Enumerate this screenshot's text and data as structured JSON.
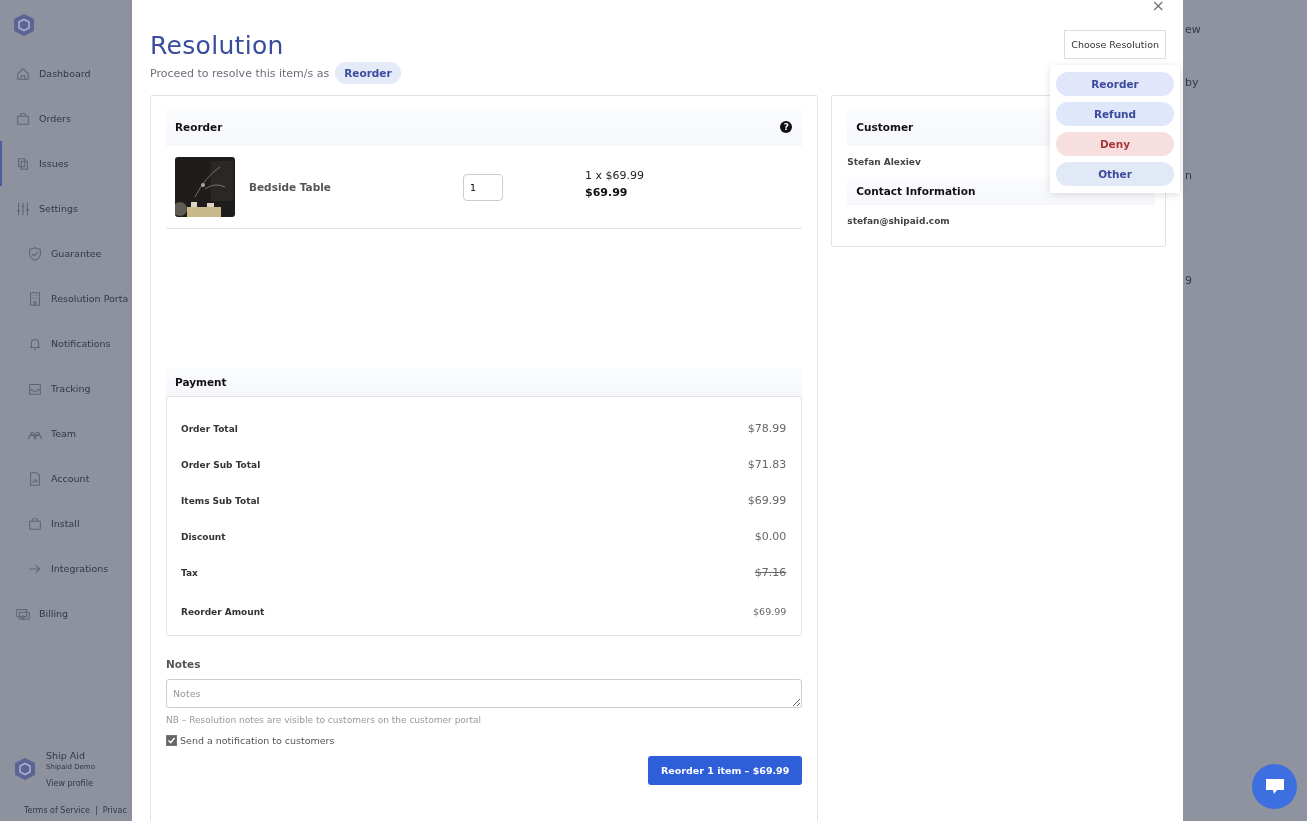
{
  "sidebar": {
    "items": [
      {
        "label": "Dashboard",
        "selected": false
      },
      {
        "label": "Orders",
        "selected": false
      },
      {
        "label": "Issues",
        "selected": true
      },
      {
        "label": "Settings",
        "selected": false,
        "children": [
          {
            "label": "Guarantee",
            "selected": false
          },
          {
            "label": "Resolution Porta",
            "selected": false
          },
          {
            "label": "Notifications",
            "selected": false
          },
          {
            "label": "Tracking",
            "selected": false
          },
          {
            "label": "Team",
            "selected": false
          },
          {
            "label": "Account",
            "selected": false
          },
          {
            "label": "Install",
            "selected": false
          },
          {
            "label": "Integrations",
            "selected": false
          }
        ]
      },
      {
        "label": "Billing",
        "selected": false
      }
    ],
    "profile": {
      "name": "Ship Aid",
      "store": "Shipaid Demo",
      "link": "View profile"
    },
    "footer": {
      "terms": "Terms of Service",
      "separator": "|",
      "privacy": "Privac"
    }
  },
  "background_fragments": [
    "ew",
    "by",
    "n",
    "9"
  ],
  "modal": {
    "close": "×",
    "title": "Resolution",
    "subtitle": "Proceed to resolve this item/s as",
    "badge": "Reorder",
    "choose_button": "Choose Resolution",
    "options": [
      {
        "label": "Reorder",
        "color": "#e2e6fb"
      },
      {
        "label": "Refund",
        "color": "#dfe8fa"
      },
      {
        "label": "Deny",
        "color": "#f8dfdf"
      },
      {
        "label": "Other",
        "color": "#e1e9f7"
      }
    ],
    "reorder": {
      "heading": "Reorder",
      "help": "?",
      "items": [
        {
          "name": "Bedside Table",
          "quantity": "1",
          "unit": "1 x $69.99",
          "total": "$69.99"
        }
      ]
    },
    "payment": {
      "heading": "Payment",
      "rows": [
        {
          "label": "Order Total",
          "value": "$78.99",
          "struck": false
        },
        {
          "label": "Order Sub Total",
          "value": "$71.83",
          "struck": false
        },
        {
          "label": "Items Sub Total",
          "value": "$69.99",
          "struck": false
        },
        {
          "label": "Discount",
          "value": "$0.00",
          "struck": false
        },
        {
          "label": "Tax",
          "value": "$7.16",
          "struck": true
        },
        {
          "label": "Reorder Amount",
          "value": "$69.99",
          "struck": false
        }
      ]
    },
    "notes": {
      "label": "Notes",
      "placeholder": "Notes",
      "hint": "NB – Resolution notes are visible to customers on the customer portal",
      "notify": {
        "label": "Send a notification to customers",
        "checked": true
      }
    },
    "submit": "Reorder 1 item – $69.99",
    "customer": {
      "heading": "Customer",
      "name": "Stefan Alexiev",
      "contact_heading": "Contact Information",
      "email": "stefan@shipaid.com"
    }
  }
}
